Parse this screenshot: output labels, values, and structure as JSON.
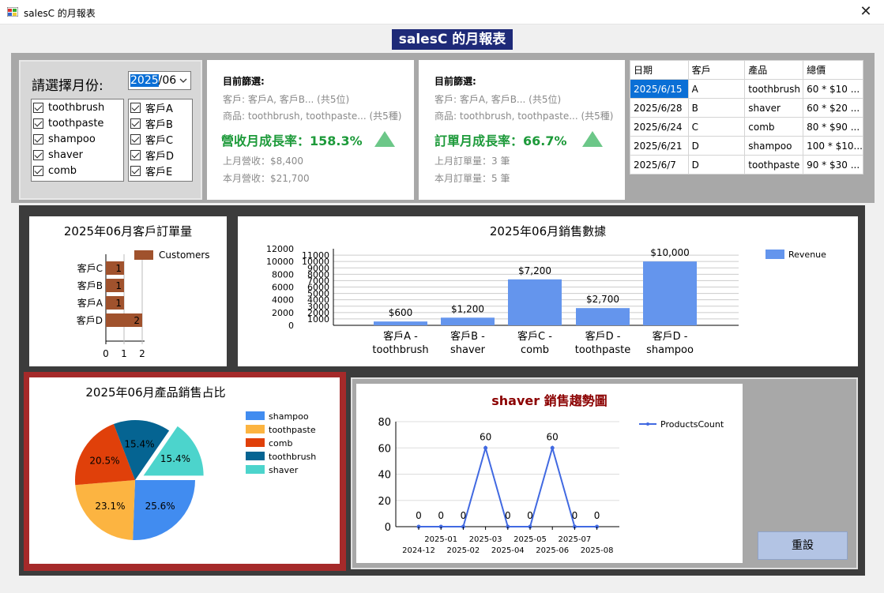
{
  "window": {
    "title": "salesC 的月報表",
    "close_glyph": "✕"
  },
  "header": {
    "title": "salesC 的月報表"
  },
  "filter": {
    "label": "請選擇月份:",
    "month_year": "2025",
    "month_rest": "/06",
    "products": [
      "toothbrush",
      "toothpaste",
      "shampoo",
      "shaver",
      "comb"
    ],
    "customers": [
      "客戶A",
      "客戶B",
      "客戶C",
      "客戶D",
      "客戶E"
    ]
  },
  "revenue_card": {
    "heading": "目前篩選:",
    "customers_line": "客戶: 客戶A, 客戶B... (共5位)",
    "products_line": "商品: toothbrush, toothpaste... (共5種)",
    "growth": "營收月成長率：158.3%",
    "last": "上月營收：$8,400",
    "current": "本月營收：$21,700",
    "arrow": "up-arrow-icon"
  },
  "orders_card": {
    "heading": "目前篩選:",
    "customers_line": "客戶: 客戶A, 客戶B... (共5位)",
    "products_line": "商品: toothbrush, toothpaste... (共5種)",
    "growth": "訂單月成長率：66.7%",
    "last": "上月訂單量：3 筆",
    "current": "本月訂單量：5 筆",
    "arrow": "up-arrow-icon"
  },
  "orders_table": {
    "headers": [
      "日期",
      "客戶",
      "產品",
      "總價"
    ],
    "rows": [
      [
        "2025/6/15",
        "A",
        "toothbrush",
        "60 * $10 ..."
      ],
      [
        "2025/6/28",
        "B",
        "shaver",
        "60 * $20 ..."
      ],
      [
        "2025/6/24",
        "C",
        "comb",
        "80 * $90 ..."
      ],
      [
        "2025/6/21",
        "D",
        "shampoo",
        "100 * $10..."
      ],
      [
        "2025/6/7",
        "D",
        "toothpaste",
        "90 * $30 ..."
      ]
    ]
  },
  "reset_label": "重設",
  "colors": {
    "accent": "#1e2a78",
    "bar_blue": "#6495ed",
    "bar_brown": "#a0522d",
    "line_blue": "#4169e1",
    "pie_highlight_border": "#a52a2a"
  },
  "chart_data": [
    {
      "type": "bar",
      "orientation": "horizontal",
      "title": "2025年06月客戶訂單量",
      "categories": [
        "客戶C",
        "客戶B",
        "客戶A",
        "客戶D"
      ],
      "series": [
        {
          "name": "Customers",
          "values": [
            1,
            1,
            1,
            2
          ]
        }
      ],
      "xticks": [
        "0",
        "1",
        "2"
      ],
      "xlim": [
        0,
        2
      ],
      "legend": "top-right"
    },
    {
      "type": "bar",
      "title": "2025年06月銷售數據",
      "categories": [
        "客戶A - toothbrush",
        "客戶B - shaver",
        "客戶C - comb",
        "客戶D - toothpaste",
        "客戶D - shampoo"
      ],
      "series": [
        {
          "name": "Revenue",
          "values": [
            600,
            1200,
            7200,
            2700,
            10000
          ]
        }
      ],
      "data_labels": [
        "$600",
        "$1,200",
        "$7,200",
        "$2,700",
        "$10,000"
      ],
      "yticks_left": [
        "0",
        "2000",
        "4000",
        "6000",
        "8000",
        "10000",
        "12000"
      ],
      "yticks_right": [
        "1000",
        "2000",
        "3000",
        "4000",
        "5000",
        "6000",
        "7000",
        "8000",
        "9000",
        "10000",
        "11000"
      ],
      "ylim": [
        0,
        12000
      ],
      "grid": true,
      "legend": "top-right"
    },
    {
      "type": "pie",
      "title": "2025年06月產品銷售占比",
      "labels": [
        "shampoo",
        "toothpaste",
        "comb",
        "toothbrush",
        "shaver"
      ],
      "values": [
        25.6,
        23.1,
        20.5,
        15.4,
        15.4
      ],
      "value_labels": [
        "25.6%",
        "23.1%",
        "20.5%",
        "15.4%",
        "15.4%"
      ],
      "colors": [
        "#418cf0",
        "#fcb441",
        "#e0400a",
        "#056492",
        "#4cd4cc"
      ],
      "exploded": "shaver",
      "legend": "right"
    },
    {
      "type": "line",
      "title": "shaver 銷售趨勢圖",
      "x": [
        "2024-12",
        "2025-01",
        "2025-02",
        "2025-03",
        "2025-04",
        "2025-05",
        "2025-06",
        "2025-07",
        "2025-08"
      ],
      "series": [
        {
          "name": "ProductsCount",
          "values": [
            0,
            0,
            0,
            60,
            0,
            0,
            60,
            0,
            0
          ]
        }
      ],
      "yticks": [
        "0",
        "20",
        "40",
        "60",
        "80"
      ],
      "ylim": [
        0,
        80
      ],
      "legend": "top-right"
    }
  ]
}
